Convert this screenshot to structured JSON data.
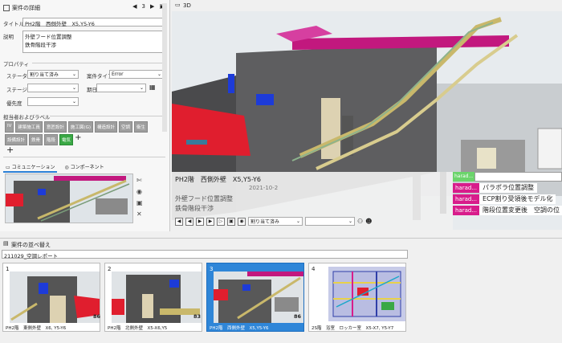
{
  "left_panel": {
    "title": "案件の詳細",
    "page": "3",
    "title_label": "タイトル",
    "title_value": "PH2階　西側外壁　X5,Y5-Y6",
    "desc_label": "説明",
    "desc_lines": [
      "外壁フード位置調整",
      "鉄骨階段干渉"
    ],
    "properties_label": "プロパティ",
    "status_label": "ステータス",
    "status_value": "割り当て済み",
    "type_label": "案件タイプ",
    "type_value": "Error",
    "stage_label": "ステージ",
    "stage_value": "",
    "due_label": "期日",
    "due_value": "",
    "priority_label": "優先度",
    "priority_value": "",
    "assignee_label": "担当者およびラベル",
    "tags": [
      "IV",
      "建築施工員",
      "意匠設計",
      "施工図(G)",
      "構造設計",
      "空調",
      "衛生",
      "設備設計",
      "鉄骨",
      "階段",
      "電気"
    ],
    "add_symbol": "+",
    "tab_communication": "コミュニケーション",
    "tab_component": "コンポーネント"
  },
  "viewport": {
    "label": "3D",
    "comment_title": "PH2階　西側外壁　X5,Y5-Y6",
    "comment_date": "2021-10-2",
    "comment_lines": [
      "外壁フード位置調整",
      "鉄骨階段干渉"
    ],
    "status_value": "割り当て済み",
    "flags": [
      {
        "user": "harad...",
        "text": "パラポラ位置調整"
      },
      {
        "user": "harad...",
        "text": "ECP割り受領後モデル化"
      },
      {
        "user": "harad...",
        "text": "階段位置変更後　空調の位"
      }
    ],
    "flag_top_user": "harad..."
  },
  "bottom": {
    "title": "案件の並べ替え",
    "report_name": "211029_空調レポート",
    "cards": [
      {
        "num": "1",
        "caption": "PH2階　東側外壁　X6, Y5-Y6",
        "badge": "86"
      },
      {
        "num": "2",
        "caption": "PH2階　北側外壁　X5-X6,Y5",
        "badge": "83"
      },
      {
        "num": "3",
        "caption": "PH2階　西側外壁　X5,Y5-Y6",
        "badge": "86"
      },
      {
        "num": "4",
        "caption": "2S階　浴室　ロッカー室　X5-X7, Y5-Y7",
        "badge": ""
      }
    ]
  },
  "colors": {
    "accent": "#2f86d8",
    "issue_red": "#e01e2e",
    "magenta": "#d81c8b",
    "tag_green": "#3aa845"
  }
}
